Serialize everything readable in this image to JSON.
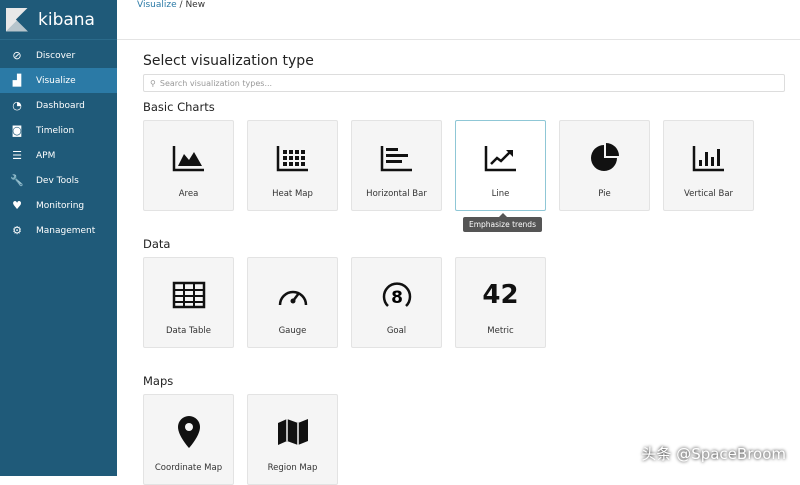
{
  "brand": "kibana",
  "nav": [
    {
      "label": "Discover",
      "icon": "compass-icon",
      "g": "⊘"
    },
    {
      "label": "Visualize",
      "icon": "bar-chart-icon",
      "g": "▟"
    },
    {
      "label": "Dashboard",
      "icon": "dashboard-icon",
      "g": "◔"
    },
    {
      "label": "Timelion",
      "icon": "timelion-icon",
      "g": "◙"
    },
    {
      "label": "APM",
      "icon": "apm-icon",
      "g": "☰"
    },
    {
      "label": "Dev Tools",
      "icon": "wrench-icon",
      "g": "🔧"
    },
    {
      "label": "Monitoring",
      "icon": "heartbeat-icon",
      "g": "♥"
    },
    {
      "label": "Management",
      "icon": "gear-icon",
      "g": "⚙"
    }
  ],
  "breadcrumb": {
    "parent": "Visualize",
    "sep": "/",
    "current": "New"
  },
  "title": "Select visualization type",
  "search": {
    "placeholder": "Search visualization types..."
  },
  "sections": [
    {
      "title": "Basic Charts",
      "items": [
        "Area",
        "Heat Map",
        "Horizontal Bar",
        "Line",
        "Pie",
        "Vertical Bar"
      ]
    },
    {
      "title": "Data",
      "items": [
        "Data Table",
        "Gauge",
        "Goal",
        "Metric"
      ]
    },
    {
      "title": "Maps",
      "items": [
        "Coordinate Map",
        "Region Map"
      ]
    }
  ],
  "metric_value": "42",
  "goal_value": "8",
  "tooltip": "Emphasize trends",
  "watermark": "头条 @SpaceBroom"
}
